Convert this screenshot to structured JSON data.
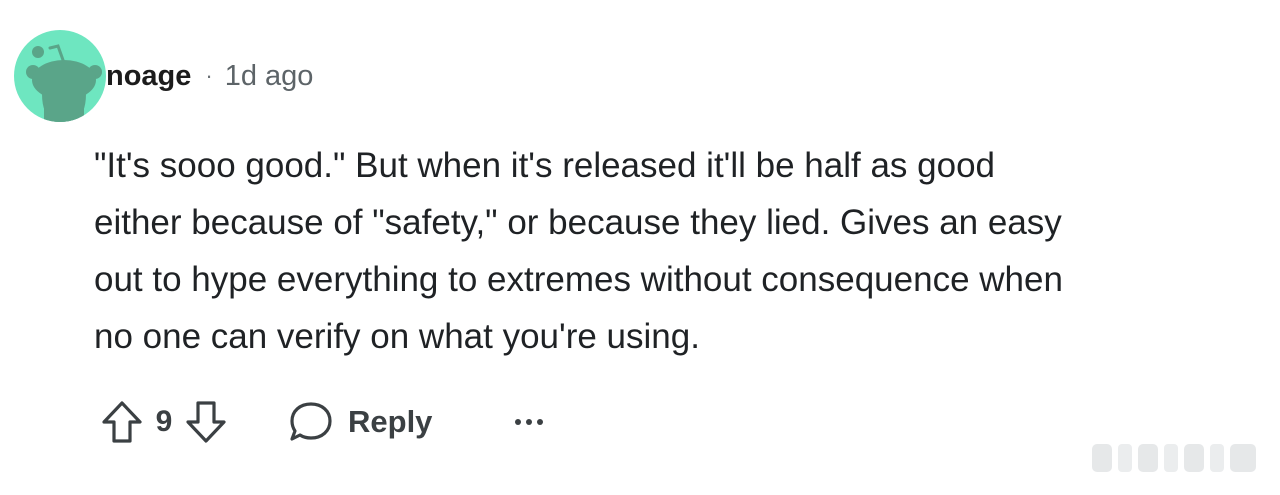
{
  "comment": {
    "author": "noage",
    "separator": "·",
    "age": "1d ago",
    "body_lines": [
      "\"It's sooo good.\" But when it's released it'll be half as good",
      "either because of \"safety,\" or because they lied. Gives an easy",
      "out to hype everything to extremes without consequence when",
      "no one can verify on what you're using."
    ],
    "score": "9",
    "reply_label": "Reply",
    "more_label": "..."
  },
  "icons": {
    "avatar": "snoo-avatar",
    "upvote": "upvote-arrow-icon",
    "downvote": "downvote-arrow-icon",
    "reply": "speech-bubble-icon",
    "more": "ellipsis-icon"
  },
  "colors": {
    "avatar_bg": "#6ee6c0",
    "avatar_figure": "#5aa589",
    "text": "#1c1c1c",
    "muted": "#5d6468",
    "action": "#3b4043"
  }
}
